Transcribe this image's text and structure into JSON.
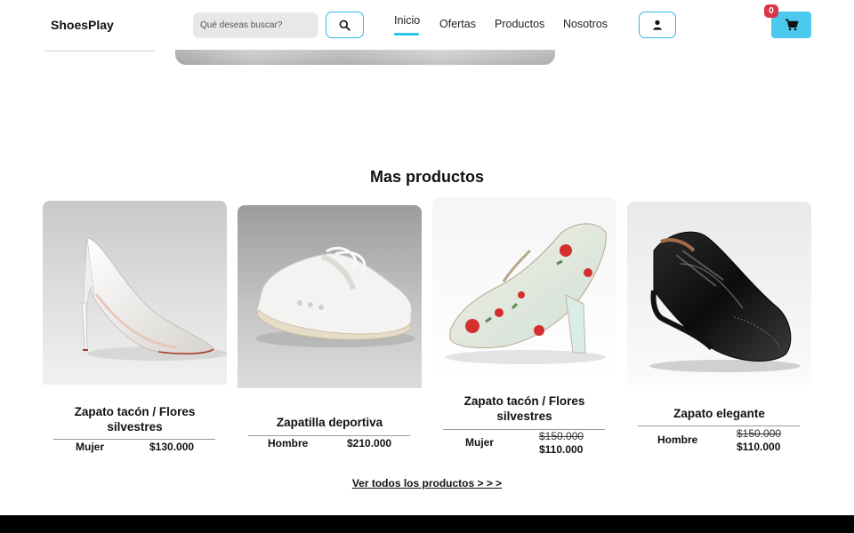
{
  "header": {
    "brand": "ShoesPlay",
    "search_placeholder": "Qué deseas buscar?",
    "search_icon": "search-icon",
    "nav": [
      "Inicio",
      "Ofertas",
      "Productos",
      "Nosotros"
    ],
    "active_nav": "Inicio",
    "user_icon": "user-icon",
    "cart_icon": "cart-icon",
    "cart_count": "0"
  },
  "section": {
    "title": "Mas productos",
    "view_all": "Ver todos los productos > > >"
  },
  "products": [
    {
      "title": "Zapato tacón / Flores silvestres",
      "category": "Mujer",
      "old_price": "",
      "price": "$130.000",
      "image": "white-pump-heel-image"
    },
    {
      "title": "Zapatilla deportiva",
      "category": "Hombre",
      "old_price": "",
      "price": "$210.000",
      "image": "white-sneaker-image"
    },
    {
      "title": "Zapato tacón / Flores silvestres",
      "category": "Mujer",
      "old_price": "$150.000",
      "price": "$110.000",
      "image": "floral-heel-image"
    },
    {
      "title": "Zapato elegante",
      "category": "Hombre",
      "old_price": "$150.000",
      "price": "$110.000",
      "image": "black-oxford-image"
    }
  ],
  "colors": {
    "accent": "#2fc3ea",
    "cart_button": "#4dc9ef",
    "badge": "#dc3545",
    "footer": "#000000"
  }
}
